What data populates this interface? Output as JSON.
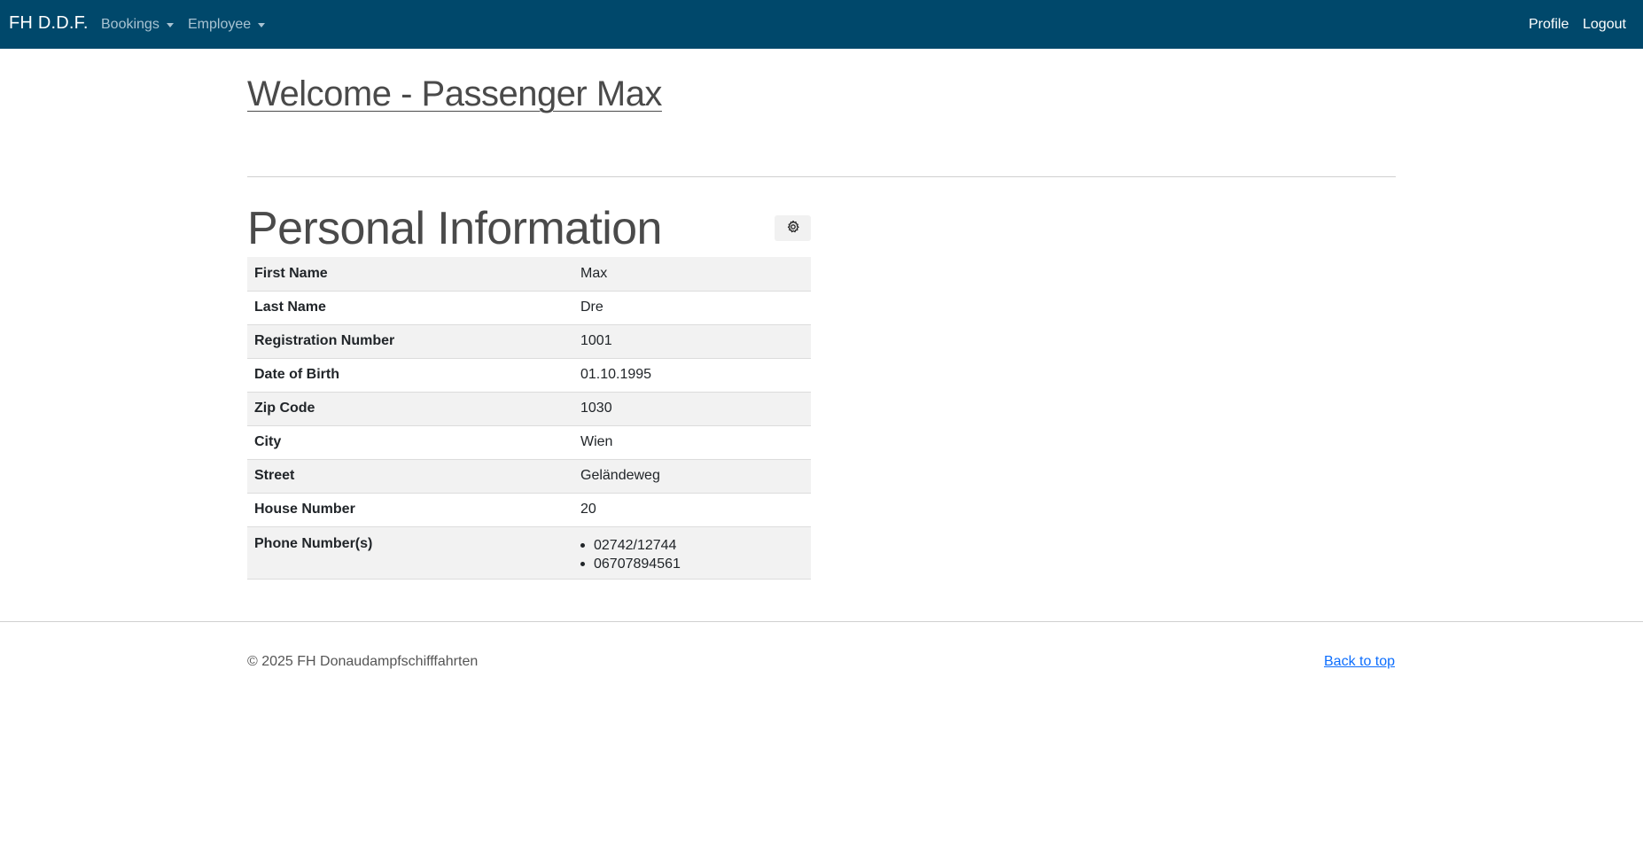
{
  "navbar": {
    "brand": "FH D.D.F.",
    "dropdowns": [
      {
        "label": "Bookings"
      },
      {
        "label": "Employee"
      }
    ],
    "profile_label": "Profile",
    "logout_label": "Logout"
  },
  "page": {
    "welcome": "Welcome - Passenger Max",
    "section_title": "Personal Information"
  },
  "personal_info": {
    "rows": [
      {
        "label": "First Name",
        "value": "Max"
      },
      {
        "label": "Last Name",
        "value": "Dre"
      },
      {
        "label": "Registration Number",
        "value": "1001"
      },
      {
        "label": "Date of Birth",
        "value": "01.10.1995"
      },
      {
        "label": "Zip Code",
        "value": "1030"
      },
      {
        "label": "City",
        "value": "Wien"
      },
      {
        "label": "Street",
        "value": "Geländeweg"
      },
      {
        "label": "House Number",
        "value": "20"
      }
    ],
    "phone_label": "Phone Number(s)",
    "phones": [
      "02742/12744",
      "06707894561"
    ]
  },
  "footer": {
    "copyright": "© 2025 FH Donaudampfschifffahrten",
    "back_to_top": "Back to top"
  },
  "colors": {
    "navbar_bg": "#00486b",
    "link": "#0d6efd"
  },
  "icons": {
    "settings": "gear-icon"
  }
}
